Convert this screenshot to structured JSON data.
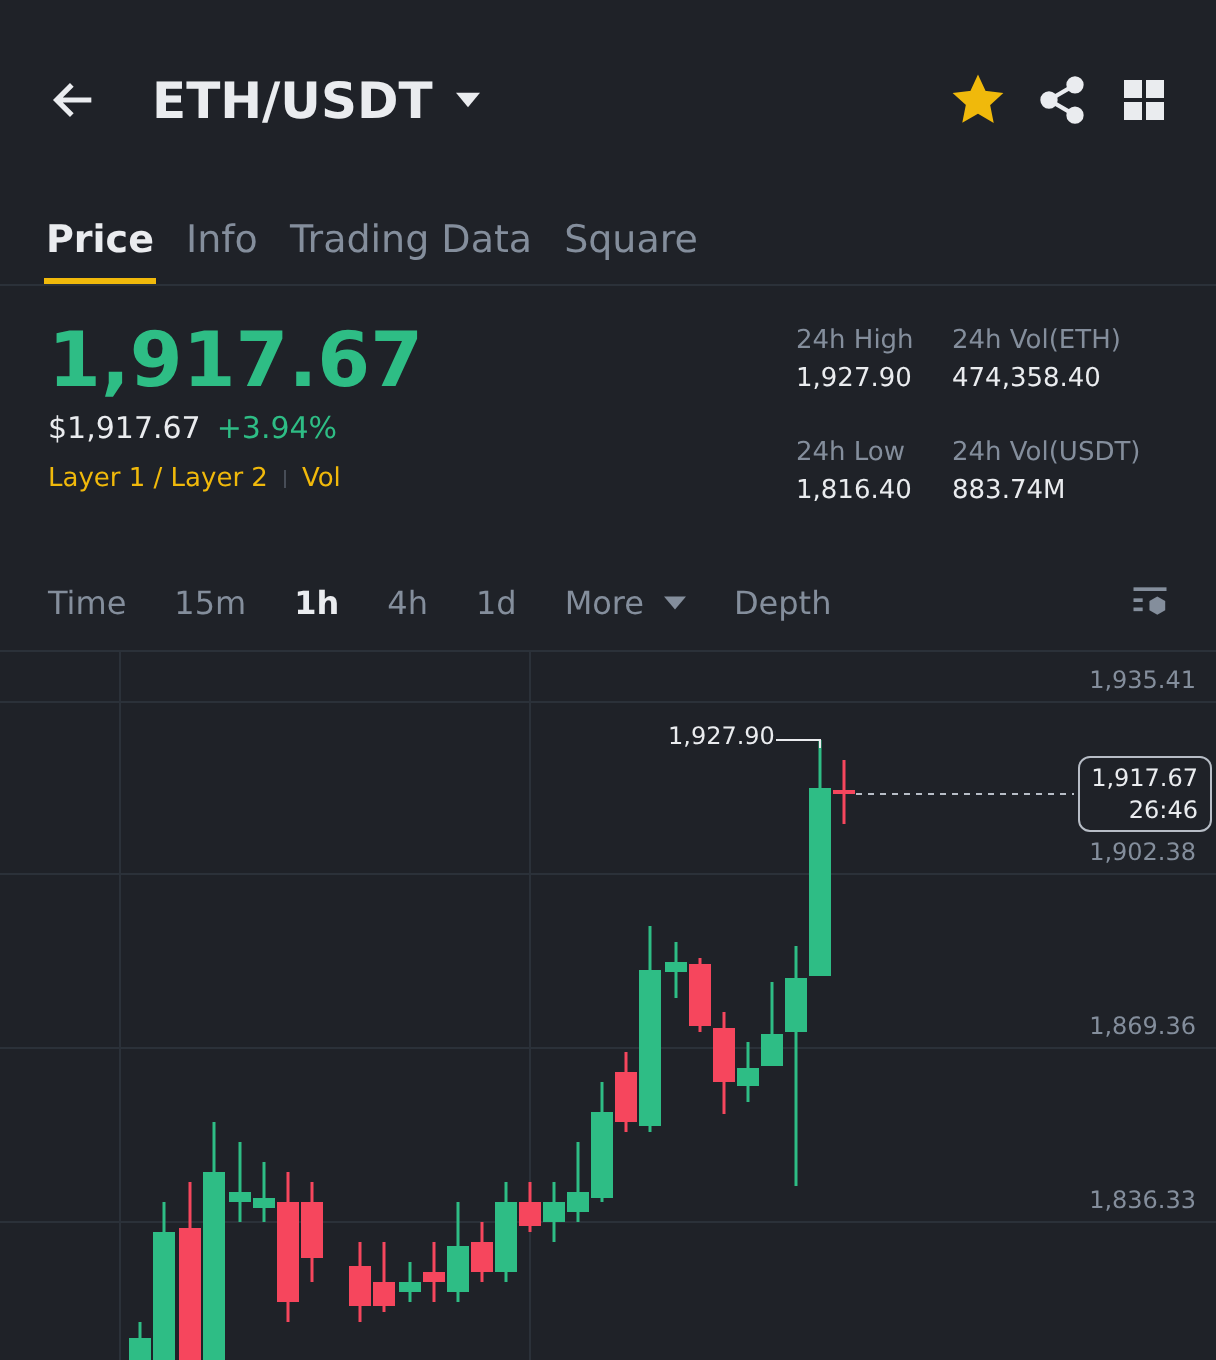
{
  "header": {
    "pair": "ETH/USDT",
    "favorite": true
  },
  "tabs": [
    {
      "label": "Price",
      "selected": true
    },
    {
      "label": "Info",
      "selected": false
    },
    {
      "label": "Trading Data",
      "selected": false
    },
    {
      "label": "Square",
      "selected": false
    }
  ],
  "price": {
    "last": "1,917.67",
    "usd": "$1,917.67",
    "change": "+3.94%",
    "tags": [
      "Layer 1 / Layer 2",
      "Vol"
    ]
  },
  "stats": [
    {
      "label": "24h High",
      "value": "1,927.90"
    },
    {
      "label": "24h Vol(ETH)",
      "value": "474,358.40"
    },
    {
      "label": "24h Low",
      "value": "1,816.40"
    },
    {
      "label": "24h Vol(USDT)",
      "value": "883.74M"
    }
  ],
  "intervals": [
    {
      "label": "Time",
      "kind": "plain",
      "selected": false
    },
    {
      "label": "15m",
      "kind": "plain",
      "selected": false
    },
    {
      "label": "1h",
      "kind": "plain",
      "selected": true
    },
    {
      "label": "4h",
      "kind": "plain",
      "selected": false
    },
    {
      "label": "1d",
      "kind": "plain",
      "selected": false
    },
    {
      "label": "More",
      "kind": "menu",
      "selected": false
    },
    {
      "label": "Depth",
      "kind": "plain",
      "selected": false
    }
  ],
  "chart": {
    "price_axis": [
      "1,935.41",
      "1,902.38",
      "1,869.36",
      "1,836.33"
    ],
    "high_marker": "1,927.90",
    "current_price": "1,917.67",
    "countdown": "26:46"
  }
}
